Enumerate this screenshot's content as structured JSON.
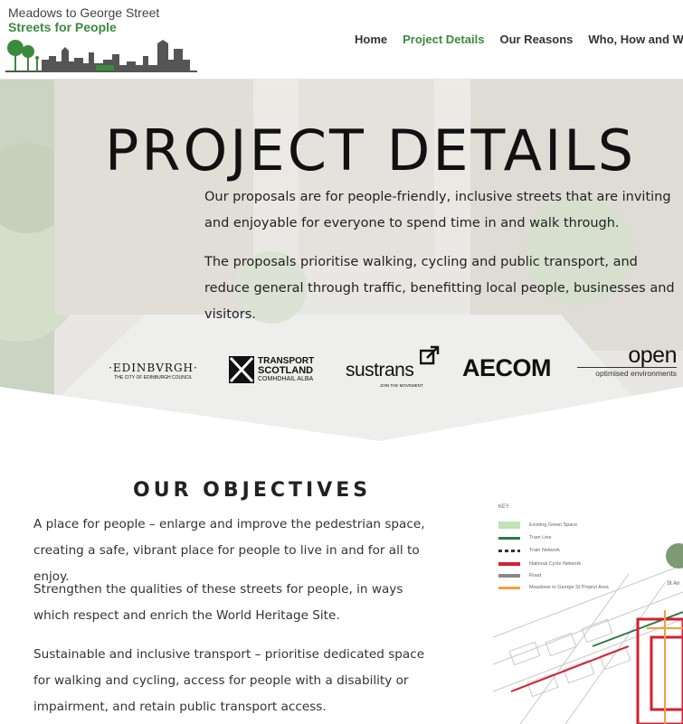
{
  "header": {
    "logo_line1": "Meadows to George Street",
    "logo_line2": "Streets for People"
  },
  "nav": {
    "items": [
      {
        "label": "Home",
        "active": false
      },
      {
        "label": "Project Details",
        "active": true
      },
      {
        "label": "Our Reasons",
        "active": false
      },
      {
        "label": "Who, How and When",
        "active": false
      }
    ]
  },
  "hero": {
    "title": "PROJECT DETAILS",
    "paragraph1": "Our proposals are for people-friendly, inclusive streets that are inviting and enjoyable for everyone to spend time in and walk through.",
    "paragraph2": "The proposals prioritise walking, cycling and public transport, and reduce general through traffic, benefitting local people, businesses and visitors."
  },
  "partners": {
    "edinburgh": "·EDINBVRGH·",
    "edinburgh_sub": "THE CITY OF EDINBURGH COUNCIL",
    "transport_1": "TRANSPORT",
    "transport_2": "SCOTLAND",
    "transport_3": "COMHDHAIL ALBA",
    "sustrans": "sustrans",
    "sustrans_sub": "JOIN THE MOVEMENT",
    "aecom": "AECOM",
    "open": "open",
    "open_sub": "optimised environments"
  },
  "objectives": {
    "title": "OUR OBJECTIVES",
    "items": [
      "A place for people – enlarge and improve the pedestrian space, creating a safe, vibrant place for people to live in and for all to enjoy.",
      "Strengthen the qualities of these streets for people, in ways which respect and enrich the World Heritage Site.",
      "Sustainable and inclusive transport – prioritise dedicated space for walking and cycling, access for people with a disability or impairment, and retain public transport access."
    ]
  },
  "map": {
    "key_title": "KEY",
    "key": [
      {
        "label": "Existing Green Space",
        "color": "#bfe3b4"
      },
      {
        "label": "Tram Line",
        "color": "#2e7a4a"
      },
      {
        "label": "Train Network",
        "color": "#333333"
      },
      {
        "label": "National Cycle Network",
        "color": "#d42030"
      },
      {
        "label": "Road",
        "color": "#888888"
      },
      {
        "label": "Meadows to George St Project Area",
        "color": "#f0a040"
      }
    ],
    "place_label": "St An"
  },
  "colors": {
    "accent_green": "#3c8a3c",
    "text_dark": "#222222"
  }
}
